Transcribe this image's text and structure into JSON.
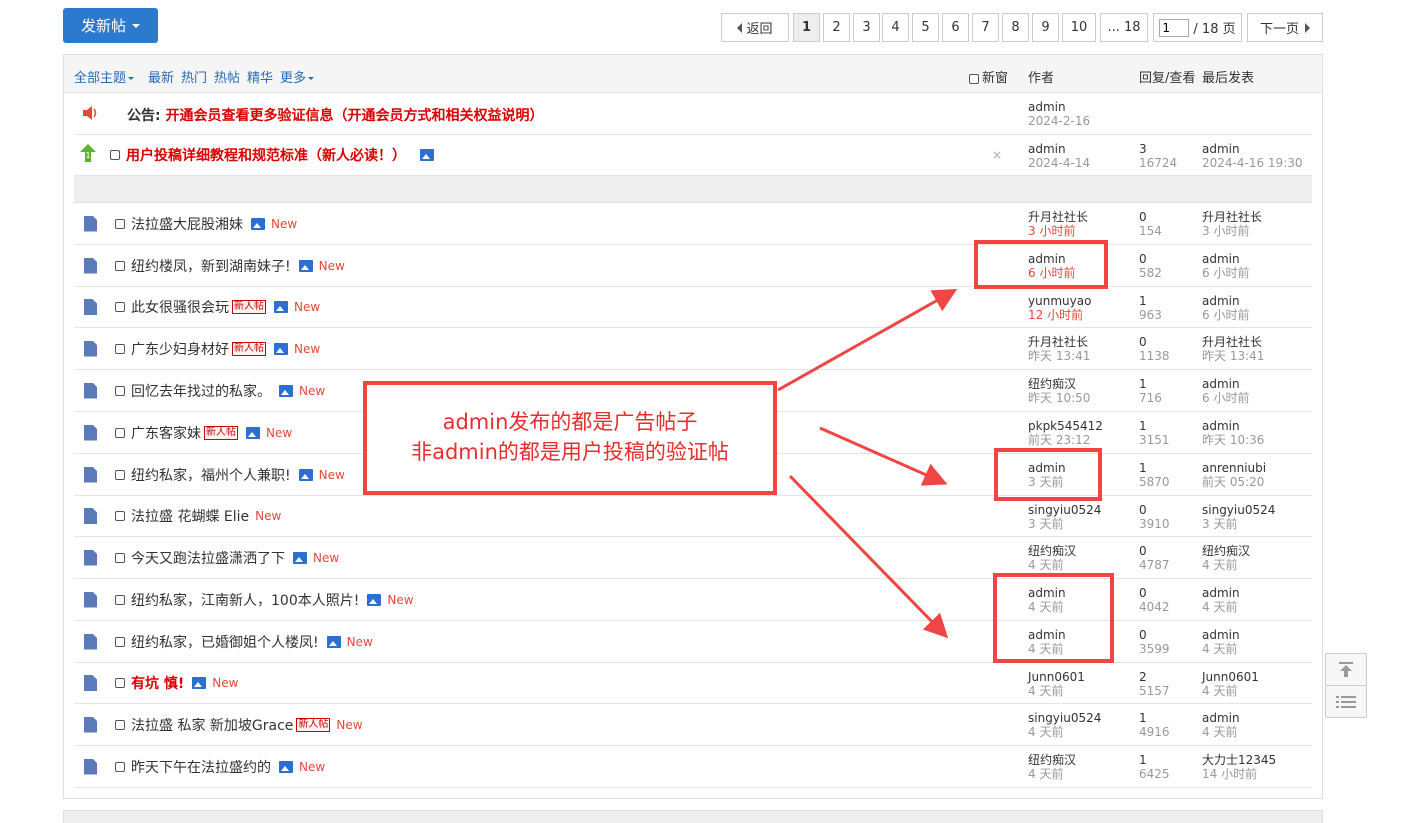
{
  "toolbar": {
    "post_label": "发新帖",
    "back_label": "返回",
    "pages": [
      "1",
      "2",
      "3",
      "4",
      "5",
      "6",
      "7",
      "8",
      "9",
      "10"
    ],
    "ellipsis_last": "... 18",
    "page_input_value": "1",
    "total_pages": "/ 18 页",
    "next_label": "下一页"
  },
  "header": {
    "all_topics": "全部主题",
    "latest": "最新",
    "hot": "热门",
    "hot_posts": "热帖",
    "featured": "精华",
    "more": "更多",
    "new_window": "新窗",
    "author": "作者",
    "reply_view": "回复/查看",
    "last_post": "最后发表"
  },
  "announcement": {
    "prefix": "公告:",
    "title": "开通会员查看更多验证信息（开通会员方式和相关权益说明）",
    "author": "admin",
    "date": "2024-2-16"
  },
  "pinned": {
    "title": "用户投稿详细教程和规范标准（新人必读！）",
    "author": "admin",
    "date": "2024-4-14",
    "replies": "3",
    "views": "16724",
    "last_user": "admin",
    "last_time": "2024-4-16 19:30",
    "close": "×"
  },
  "threads": [
    {
      "title": "法拉盛大屁股湘妹",
      "red": false,
      "newbie": false,
      "img": true,
      "new": "New",
      "author": "升月社社长",
      "time": "3 小时前",
      "time_red": true,
      "replies": "0",
      "views": "154",
      "last_user": "升月社社长",
      "last_time": "3 小时前"
    },
    {
      "title": "纽约楼凤，新到湖南妹子!",
      "red": false,
      "newbie": false,
      "img": true,
      "new": "New",
      "author": "admin",
      "time": "6 小时前",
      "time_red": true,
      "replies": "0",
      "views": "582",
      "last_user": "admin",
      "last_time": "6 小时前"
    },
    {
      "title": "此女很骚很会玩",
      "red": false,
      "newbie": true,
      "img": true,
      "new": "New",
      "author": "yunmuyao",
      "time": "12 小时前",
      "time_red": true,
      "replies": "1",
      "views": "963",
      "last_user": "admin",
      "last_time": "6 小时前"
    },
    {
      "title": "广东少妇身材好",
      "red": false,
      "newbie": true,
      "img": true,
      "new": "New",
      "author": "升月社社长",
      "time": "昨天 13:41",
      "time_red": false,
      "replies": "0",
      "views": "1138",
      "last_user": "升月社社长",
      "last_time": "昨天 13:41"
    },
    {
      "title": "回忆去年找过的私家。",
      "red": false,
      "newbie": false,
      "img": true,
      "new": "New",
      "author": "纽约痴汉",
      "time": "昨天 10:50",
      "time_red": false,
      "replies": "1",
      "views": "716",
      "last_user": "admin",
      "last_time": "6 小时前"
    },
    {
      "title": "广东客家妹",
      "red": false,
      "newbie": true,
      "img": true,
      "new": "New",
      "author": "pkpk545412",
      "time": "前天 23:12",
      "time_red": false,
      "replies": "1",
      "views": "3151",
      "last_user": "admin",
      "last_time": "昨天 10:36"
    },
    {
      "title": "纽约私家，福州个人兼职!",
      "red": false,
      "newbie": false,
      "img": true,
      "new": "New",
      "author": "admin",
      "time": "3 天前",
      "time_red": false,
      "replies": "1",
      "views": "5870",
      "last_user": "anrenniubi",
      "last_time": "前天 05:20"
    },
    {
      "title": "法拉盛 花蝴蝶 Elie",
      "red": false,
      "newbie": false,
      "img": false,
      "new": "New",
      "author": "singyiu0524",
      "time": "3 天前",
      "time_red": false,
      "replies": "0",
      "views": "3910",
      "last_user": "singyiu0524",
      "last_time": "3 天前"
    },
    {
      "title": "今天又跑法拉盛潇洒了下",
      "red": false,
      "newbie": false,
      "img": true,
      "new": "New",
      "author": "纽约痴汉",
      "time": "4 天前",
      "time_red": false,
      "replies": "0",
      "views": "4787",
      "last_user": "纽约痴汉",
      "last_time": "4 天前"
    },
    {
      "title": "纽约私家，江南新人，100本人照片!",
      "red": false,
      "newbie": false,
      "img": true,
      "new": "New",
      "author": "admin",
      "time": "4 天前",
      "time_red": false,
      "replies": "0",
      "views": "4042",
      "last_user": "admin",
      "last_time": "4 天前"
    },
    {
      "title": "纽约私家，已婚御姐个人楼凤!",
      "red": false,
      "newbie": false,
      "img": true,
      "new": "New",
      "author": "admin",
      "time": "4 天前",
      "time_red": false,
      "replies": "0",
      "views": "3599",
      "last_user": "admin",
      "last_time": "4 天前"
    },
    {
      "title": "有坑 慎!",
      "red": true,
      "newbie": false,
      "img": true,
      "new": "New",
      "author": "Junn0601",
      "time": "4 天前",
      "time_red": false,
      "replies": "2",
      "views": "5157",
      "last_user": "Junn0601",
      "last_time": "4 天前"
    },
    {
      "title": "法拉盛 私家 新加坡Grace",
      "red": false,
      "newbie": true,
      "img": false,
      "new": "New",
      "author": "singyiu0524",
      "time": "4 天前",
      "time_red": false,
      "replies": "1",
      "views": "4916",
      "last_user": "admin",
      "last_time": "4 天前"
    },
    {
      "title": "昨天下午在法拉盛约的",
      "red": false,
      "newbie": false,
      "img": true,
      "new": "New",
      "author": "纽约痴汉",
      "time": "4 天前",
      "time_red": false,
      "replies": "1",
      "views": "6425",
      "last_user": "大力士12345",
      "last_time": "14 小时前"
    }
  ],
  "newbie_label": "新人帖",
  "annotation": {
    "line1": "admin发布的都是广告帖子",
    "line2": "非admin的都是用户投稿的验证帖",
    "color": "#f04545"
  },
  "colors": {
    "accent": "#2b7acd",
    "link": "#2b6ab3",
    "new": "#e4493c",
    "alert": "#d90000"
  }
}
